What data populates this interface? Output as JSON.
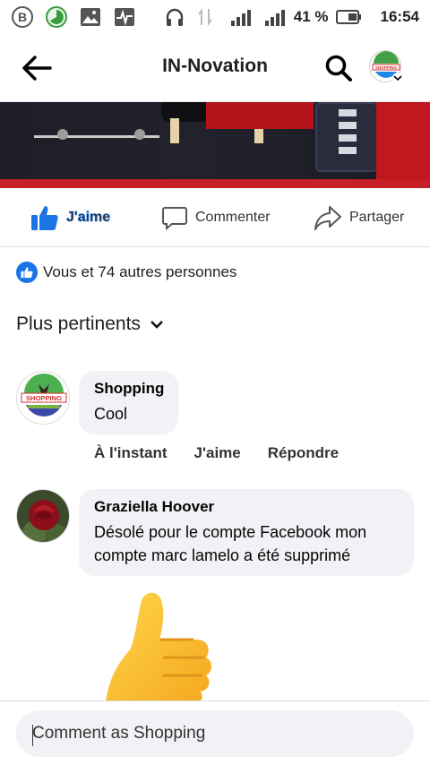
{
  "status_bar": {
    "battery_percent": "41 %",
    "time": "16:54",
    "network_1": "H+",
    "network_2": "H"
  },
  "header": {
    "title": "IN-Novation",
    "profile_logo_text": "SHOPPING"
  },
  "actions": {
    "like_label": "J'aime",
    "comment_label": "Commenter",
    "share_label": "Partager"
  },
  "reactions": {
    "summary": "Vous et 74 autres personnes"
  },
  "sort": {
    "label": "Plus pertinents"
  },
  "comments": [
    {
      "author": "Shopping",
      "text": "Cool",
      "time": "À l'instant",
      "like_label": "J'aime",
      "reply_label": "Répondre",
      "avatar_logo_text": "SHOPPING"
    },
    {
      "author": "Graziella Hoover",
      "text": "Désolé pour le compte Facebook mon compte marc lamelo a été supprimé"
    }
  ],
  "composer": {
    "placeholder": "Comment as Shopping"
  },
  "colors": {
    "facebook_blue": "#1b74e4",
    "bubble_bg": "#f0f2f5",
    "text": "#050505"
  }
}
